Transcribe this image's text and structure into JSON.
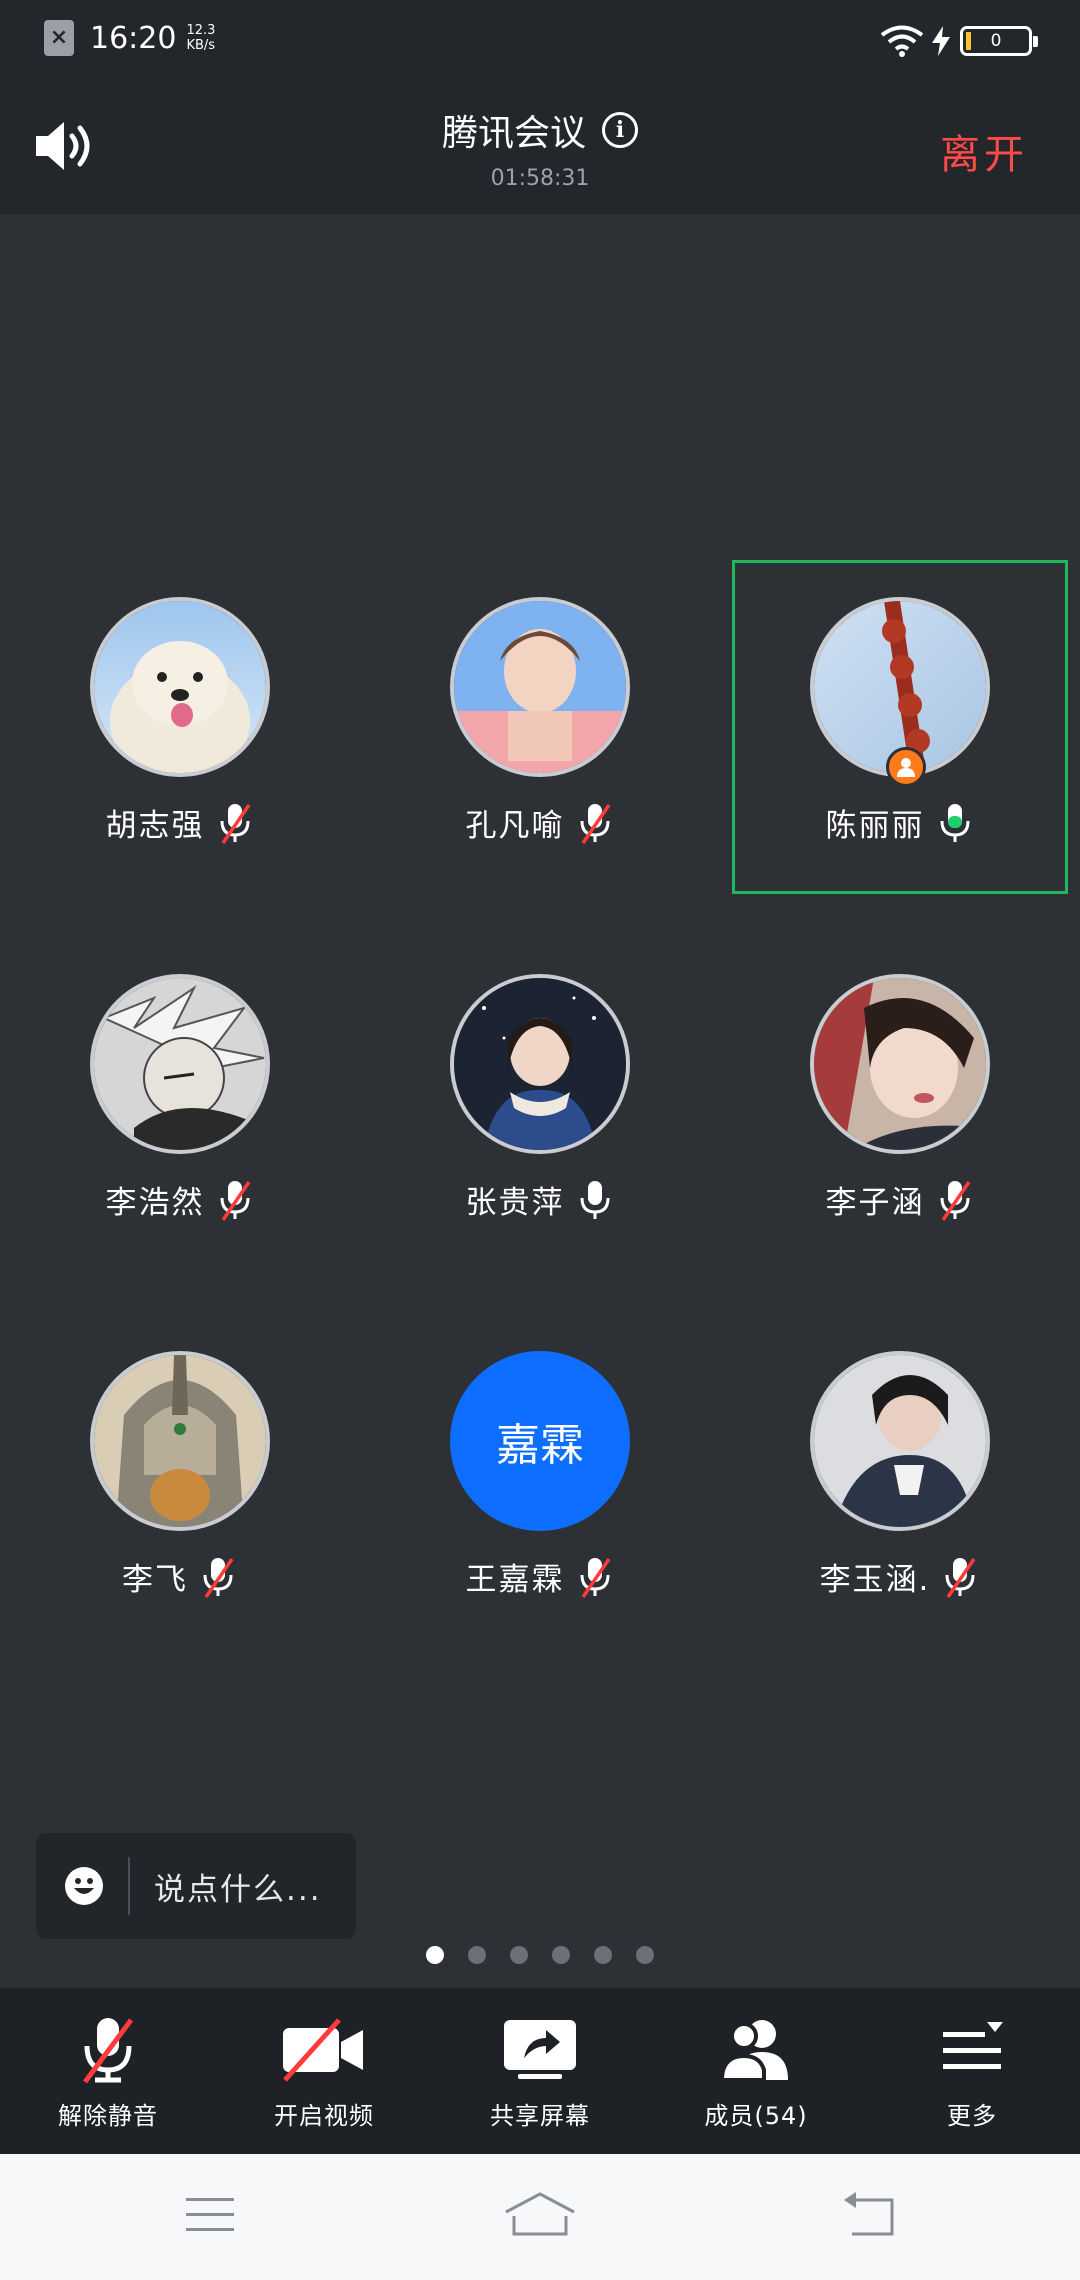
{
  "status_bar": {
    "time": "16:20",
    "net_speed_value": "12.3",
    "net_speed_unit": "KB/s",
    "battery": "0"
  },
  "header": {
    "title": "腾讯会议",
    "timer": "01:58:31",
    "leave_label": "离开"
  },
  "participants": [
    {
      "name": "胡志强",
      "mic": "muted"
    },
    {
      "name": "孔凡喻",
      "mic": "muted"
    },
    {
      "name": "陈丽丽",
      "mic": "speaking",
      "active": true,
      "host": true
    },
    {
      "name": "李浩然",
      "mic": "muted"
    },
    {
      "name": "张贵萍",
      "mic": "on"
    },
    {
      "name": "李子涵",
      "mic": "muted"
    },
    {
      "name": "李飞",
      "mic": "muted"
    },
    {
      "name": "王嘉霖",
      "mic": "muted",
      "avatar_text": "嘉霖"
    },
    {
      "name": "李玉涵.",
      "mic": "muted"
    }
  ],
  "chat": {
    "placeholder": "说点什么..."
  },
  "pager": {
    "pages": 6,
    "current": 1
  },
  "toolbar": {
    "unmute_label": "解除静音",
    "video_label": "开启视频",
    "share_label": "共享屏幕",
    "members_label": "成员(54)",
    "more_label": "更多"
  },
  "colors": {
    "leave": "#ff4b47",
    "active_border": "#1fb85c",
    "text_avatar": "#0e6eff",
    "host_badge": "#ff7a1a",
    "mute_slash": "#ff3b3b",
    "mic_active": "#1fd06a"
  }
}
